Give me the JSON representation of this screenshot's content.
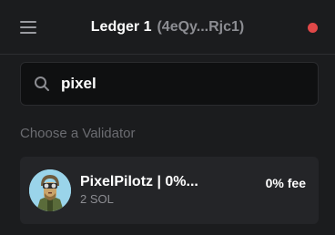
{
  "header": {
    "account_name": "Ledger 1",
    "account_address": "(4eQy...Rjc1)",
    "status_color": "#e04848",
    "menu_icon": "hamburger-menu-icon"
  },
  "search": {
    "icon": "search-icon",
    "value": "pixel"
  },
  "section": {
    "label": "Choose a Validator"
  },
  "validators": [
    {
      "name": "PixelPilotz | 0%...",
      "stake": "2 SOL",
      "fee": "0% fee",
      "avatar_icon": "pixel-pilot-avatar"
    }
  ]
}
